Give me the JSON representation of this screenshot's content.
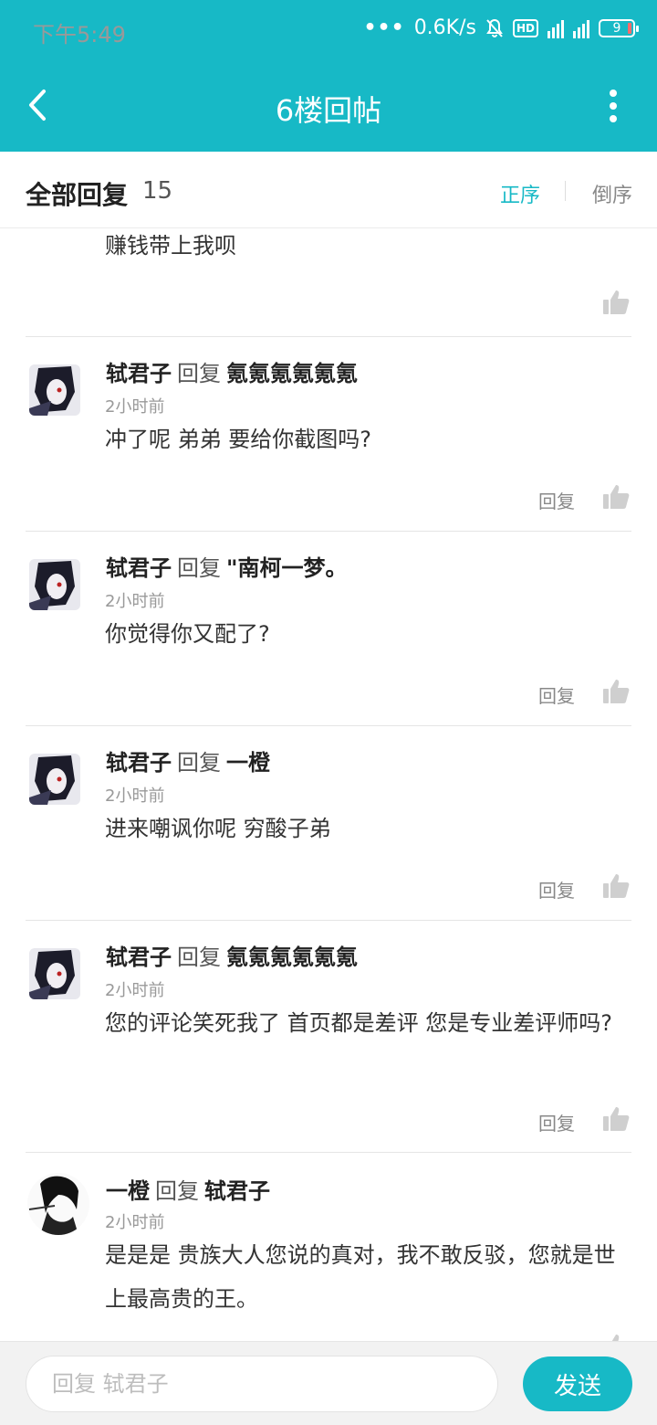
{
  "status_bar": {
    "time": "下午5:49",
    "network_speed": "0.6K/s",
    "hd_label": "HD",
    "battery": "9"
  },
  "app_bar": {
    "title": "6楼回帖"
  },
  "section": {
    "title": "全部回复",
    "count": "15",
    "sort_asc": "正序",
    "sort_desc": "倒序"
  },
  "accent_color": "#17B9C6",
  "replies": [
    {
      "content": "赚钱带上我呗"
    },
    {
      "author": "轼君子",
      "reply_word": "回复",
      "target": "氪氪氪氪氪氪",
      "time": "2小时前",
      "content": "冲了呢 弟弟 要给你截图吗?",
      "reply_label": "回复"
    },
    {
      "author": "轼君子",
      "reply_word": "回复",
      "target": "\"南柯一梦。",
      "time": "2小时前",
      "content": "你觉得你又配了?",
      "reply_label": "回复"
    },
    {
      "author": "轼君子",
      "reply_word": "回复",
      "target": "一橙",
      "time": "2小时前",
      "content": "进来嘲讽你呢 穷酸子弟",
      "reply_label": "回复"
    },
    {
      "author": "轼君子",
      "reply_word": "回复",
      "target": "氪氪氪氪氪氪",
      "time": "2小时前",
      "content": "您的评论笑死我了 首页都是差评 您是专业差评师吗?",
      "reply_label": "回复"
    },
    {
      "author": "一橙",
      "reply_word": "回复",
      "target": "轼君子",
      "time": "2小时前",
      "content": "是是是 贵族大人您说的真对，我不敢反驳，您就是世上最高贵的王。"
    }
  ],
  "input": {
    "placeholder": "回复 轼君子",
    "value": ""
  },
  "send_label": "发送"
}
